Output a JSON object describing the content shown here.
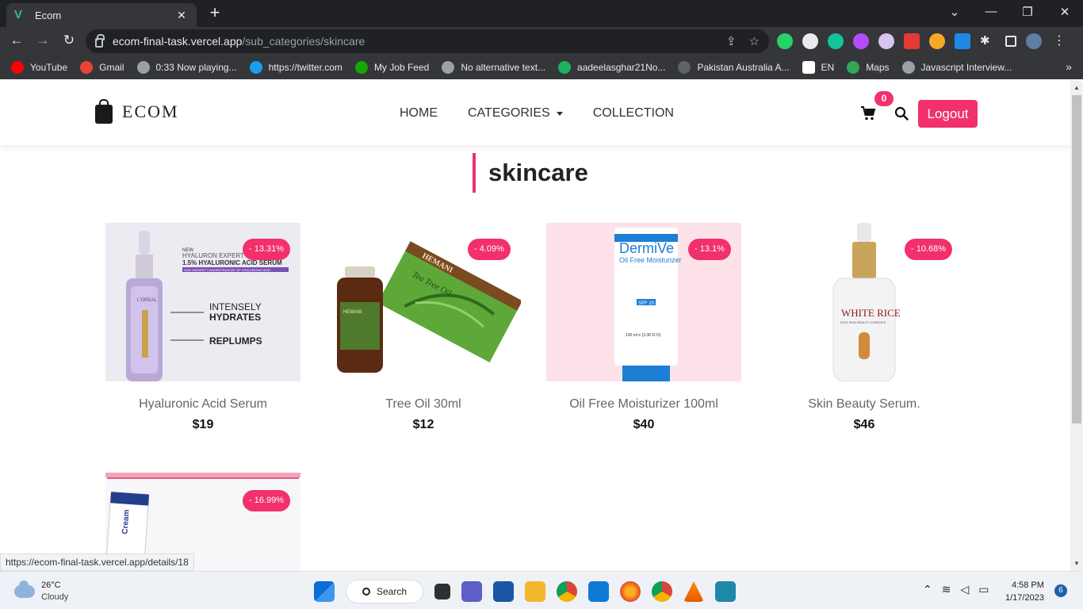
{
  "browser": {
    "tab_title": "Ecom",
    "tab_favicon": "V",
    "url_host": "ecom-final-task.vercel.app",
    "url_path": "/sub_categories/skincare",
    "bookmarks": [
      {
        "label": "YouTube",
        "color": "#ff0000"
      },
      {
        "label": "Gmail",
        "color": "#ea4335"
      },
      {
        "label": "0:33 Now playing...",
        "color": "#9aa0a6"
      },
      {
        "label": "https://twitter.com",
        "color": "#1d9bf0"
      },
      {
        "label": "My Job Feed",
        "color": "#14a800"
      },
      {
        "label": "No alternative text...",
        "color": "#9aa0a6"
      },
      {
        "label": "aadeelasghar21No...",
        "color": "#1ab35c"
      },
      {
        "label": "Pakistan Australia A...",
        "color": "#5f6368"
      },
      {
        "label": "EN",
        "color": "#ffffff"
      },
      {
        "label": "Maps",
        "color": "#34a853"
      },
      {
        "label": "Javascript Interview...",
        "color": "#9aa0a6"
      }
    ],
    "status_url": "https://ecom-final-task.vercel.app/details/18"
  },
  "site": {
    "logo_text": "ECOM",
    "nav": {
      "home": "HOME",
      "categories": "CATEGORIES",
      "collection": "COLLECTION"
    },
    "cart_count": "0",
    "logout_label": "Logout",
    "accent_color": "#f1306c"
  },
  "page_title": "skincare",
  "products": [
    {
      "name": "Hyaluronic Acid Serum",
      "price": "$19",
      "discount": "- 13.31%"
    },
    {
      "name": "Tree Oil 30ml",
      "price": "$12",
      "discount": "- 4.09%"
    },
    {
      "name": "Oil Free Moisturizer 100ml",
      "price": "$40",
      "discount": "- 13.1%"
    },
    {
      "name": "Skin Beauty Serum.",
      "price": "$46",
      "discount": "- 10.68%"
    },
    {
      "name": "",
      "price": "",
      "discount": "- 16.99%"
    }
  ],
  "product_image_text": {
    "serum_new": "NEW",
    "serum_line1": "HYALURON EXPERT",
    "serum_line2": "1.5% HYALURONIC ACID SERUM",
    "serum_line3": "OUR HIGHEST CONCENTRATION* OF HYALURONIC ACID",
    "serum_claim1a": "INTENSELY",
    "serum_claim1b": "HYDRATES",
    "serum_claim2": "REPLUMPS",
    "serum_brand": "L'OREAL",
    "oil_brand": "HEMANI",
    "oil_box": "Tea Tree Oil",
    "moist_brand": "DermiVe",
    "moist_title": "Oil Free Moisturizer",
    "moist_spf": "SPF 20",
    "moist_size": "100 ml e (3.38 Fl.O)",
    "rice_title": "WHITE RICE",
    "rice_sub": "RICE SKIN BEAUTY ESSENCE",
    "cream_label": "Cream"
  },
  "taskbar": {
    "temp": "26°C",
    "condition": "Cloudy",
    "search_label": "Search",
    "time": "4:58 PM",
    "date": "1/17/2023",
    "notifications": "6"
  }
}
